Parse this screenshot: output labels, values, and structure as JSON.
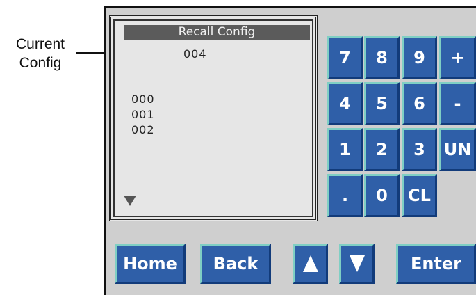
{
  "callout": {
    "line1": "Current",
    "line2": "Config"
  },
  "screen": {
    "title": "Recall Config",
    "current_value": "004",
    "items": [
      "000",
      "001",
      "002"
    ]
  },
  "keypad": {
    "row1": [
      "7",
      "8",
      "9",
      "+"
    ],
    "row2": [
      "4",
      "5",
      "6",
      "-"
    ],
    "row3": [
      "1",
      "2",
      "3",
      "UN"
    ],
    "row4": [
      ".",
      "0",
      "CL"
    ]
  },
  "bottom": {
    "home": "Home",
    "back": "Back",
    "enter": "Enter"
  },
  "icons": {
    "scroll": "triangle-down-icon",
    "up": "triangle-up-icon",
    "down": "triangle-down-icon"
  },
  "colors": {
    "key_face": "#2f5fa8",
    "key_highlight": "#7fcfc4",
    "panel": "#cfcfcf",
    "screen": "#e6e6e6",
    "title_bar": "#5b5b5b"
  }
}
